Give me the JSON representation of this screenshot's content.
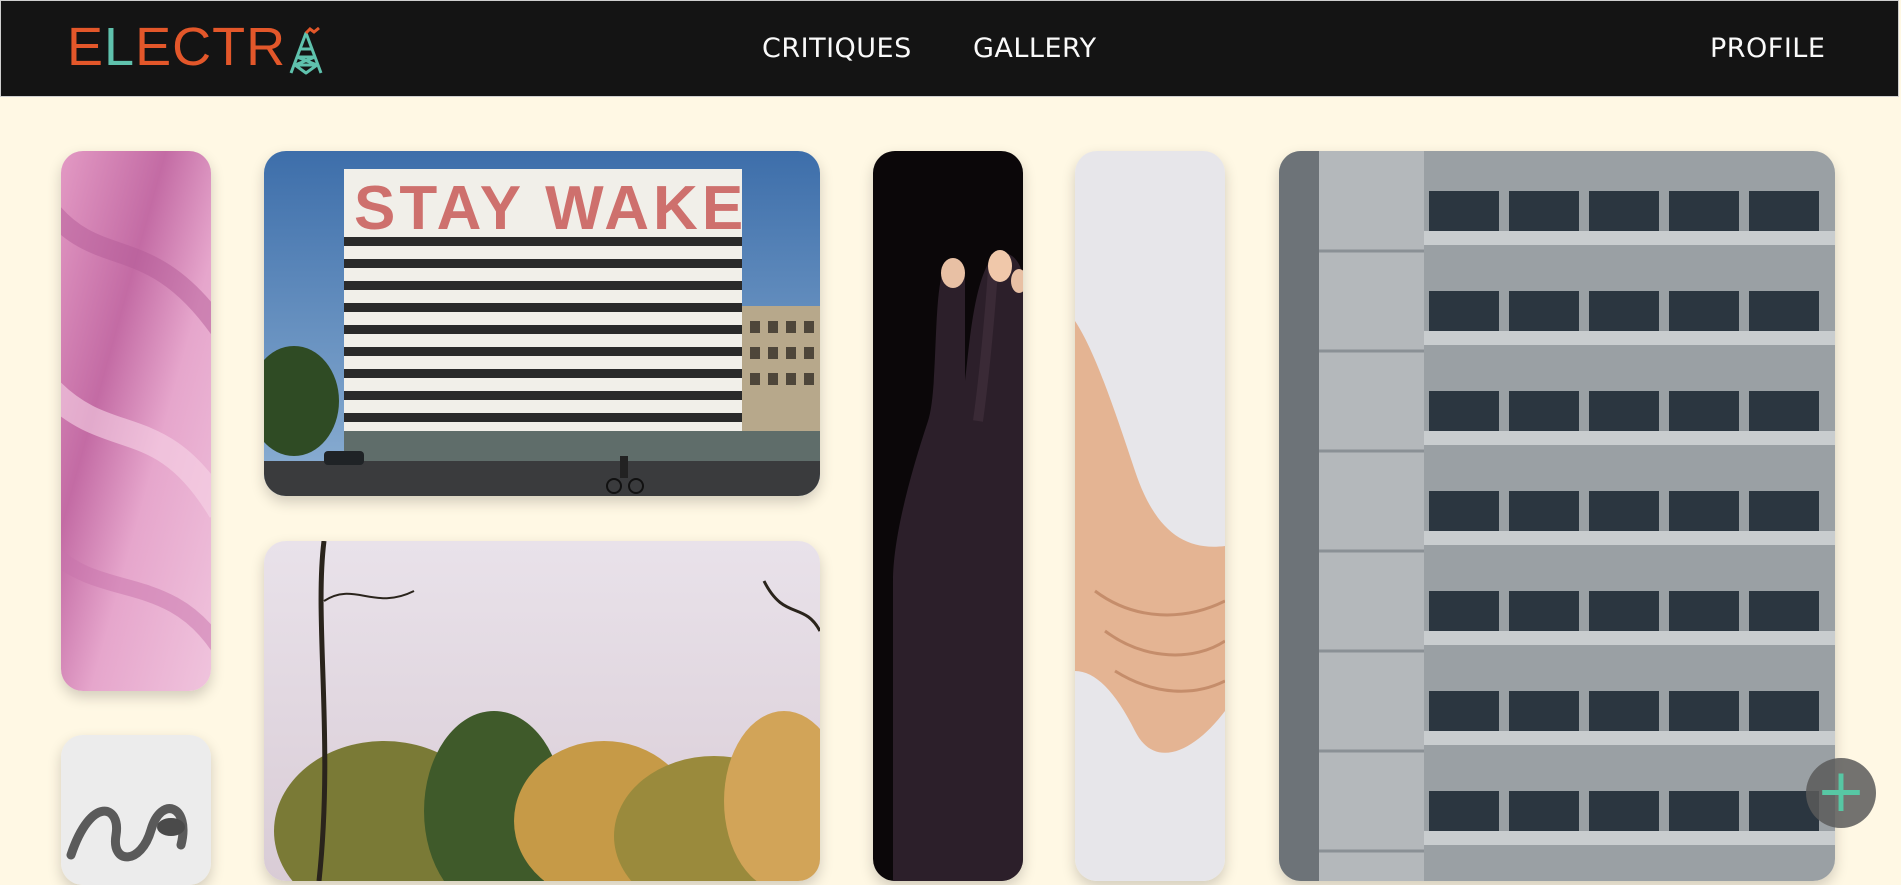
{
  "brand": {
    "name_part1": "E",
    "name_part2": "L",
    "name_part3": "ECTR",
    "logo_icon": "tower-a-icon",
    "colors": {
      "orange": "#e3572a",
      "teal": "#5fc2ad"
    }
  },
  "nav": {
    "critiques": "CRITIQUES",
    "gallery": "GALLERY",
    "profile": "PROFILE"
  },
  "gallery": {
    "tiles": [
      {
        "name": "pink-marble-tile",
        "subject": "pink marble texture"
      },
      {
        "name": "graffiti-building-tile",
        "subject": "office building with graffiti lettering",
        "graffiti_text": "STAY WAKE"
      },
      {
        "name": "dark-hand-tile",
        "subject": "hand with gold fingernails"
      },
      {
        "name": "holding-hands-tile",
        "subject": "clasped hands on white"
      },
      {
        "name": "concrete-tower-tile",
        "subject": "concrete high-rise facade"
      },
      {
        "name": "autumn-trees-tile",
        "subject": "autumn trees under a pale sky"
      },
      {
        "name": "sculpture-tile",
        "subject": "metal sculpture on grey"
      }
    ]
  },
  "fab": {
    "icon": "plus-icon",
    "symbol": "+",
    "color": "#57c7a4"
  }
}
